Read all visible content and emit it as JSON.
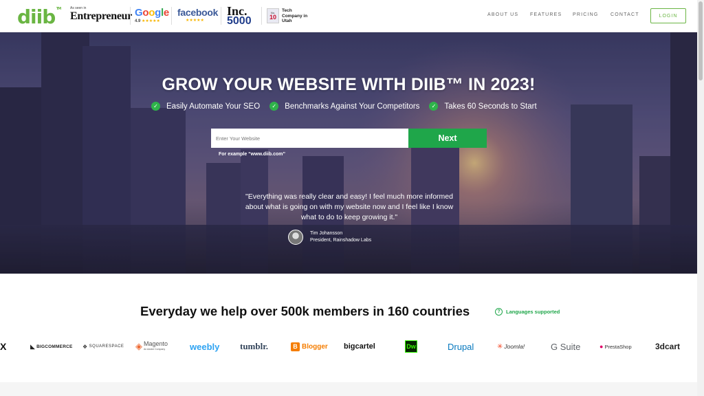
{
  "header": {
    "logo": "diib",
    "logo_tm": "TM",
    "press": {
      "entrepreneur_prefix": "As seen in",
      "entrepreneur": "Entrepreneur",
      "google": "Google",
      "google_rating": "4.9",
      "google_stars": "★★★★★",
      "facebook": "facebook",
      "facebook_stars": "★★★★★",
      "inc": "Inc.",
      "inc_number": "5000",
      "tech_no": "No.",
      "tech_rank": "10",
      "tech_text": "Tech Company in Utah"
    },
    "nav": [
      "ABOUT US",
      "FEATURES",
      "PRICING",
      "CONTACT"
    ],
    "login": "LOGIN"
  },
  "hero": {
    "title": "GROW YOUR WEBSITE WITH DIIB™ IN 2023!",
    "benefits": [
      "Easily Automate Your SEO",
      "Benchmarks Against Your Competitors",
      "Takes 60 Seconds to Start"
    ],
    "input_placeholder": "Enter Your Website",
    "next_label": "Next",
    "example": "For example “www.diib.com”",
    "quote": "\"Everything was really clear and easy! I feel much more informed about what is going on with my website now and I feel like I know what to do to keep growing it.\"",
    "author_name": "Tim Johansson",
    "author_title": "President, Rainshadow Labs"
  },
  "members": {
    "title": "Everyday we help over 500k members in 160 countries",
    "languages": "Languages supported",
    "platforms": [
      "X",
      "BIGCOMMERCE",
      "SQUARESPACE",
      "Magento",
      "weebly",
      "tumblr.",
      "Blogger",
      "bigcartel",
      "Dw",
      "Drupal",
      "Joomla!",
      "G Suite",
      "PrestaShop",
      "3dcart"
    ],
    "magento_sub": "An Adobe Company"
  },
  "colors": {
    "brand_green": "#6ab543",
    "cta_green": "#1fa64a",
    "check_green": "#2fb34a"
  }
}
